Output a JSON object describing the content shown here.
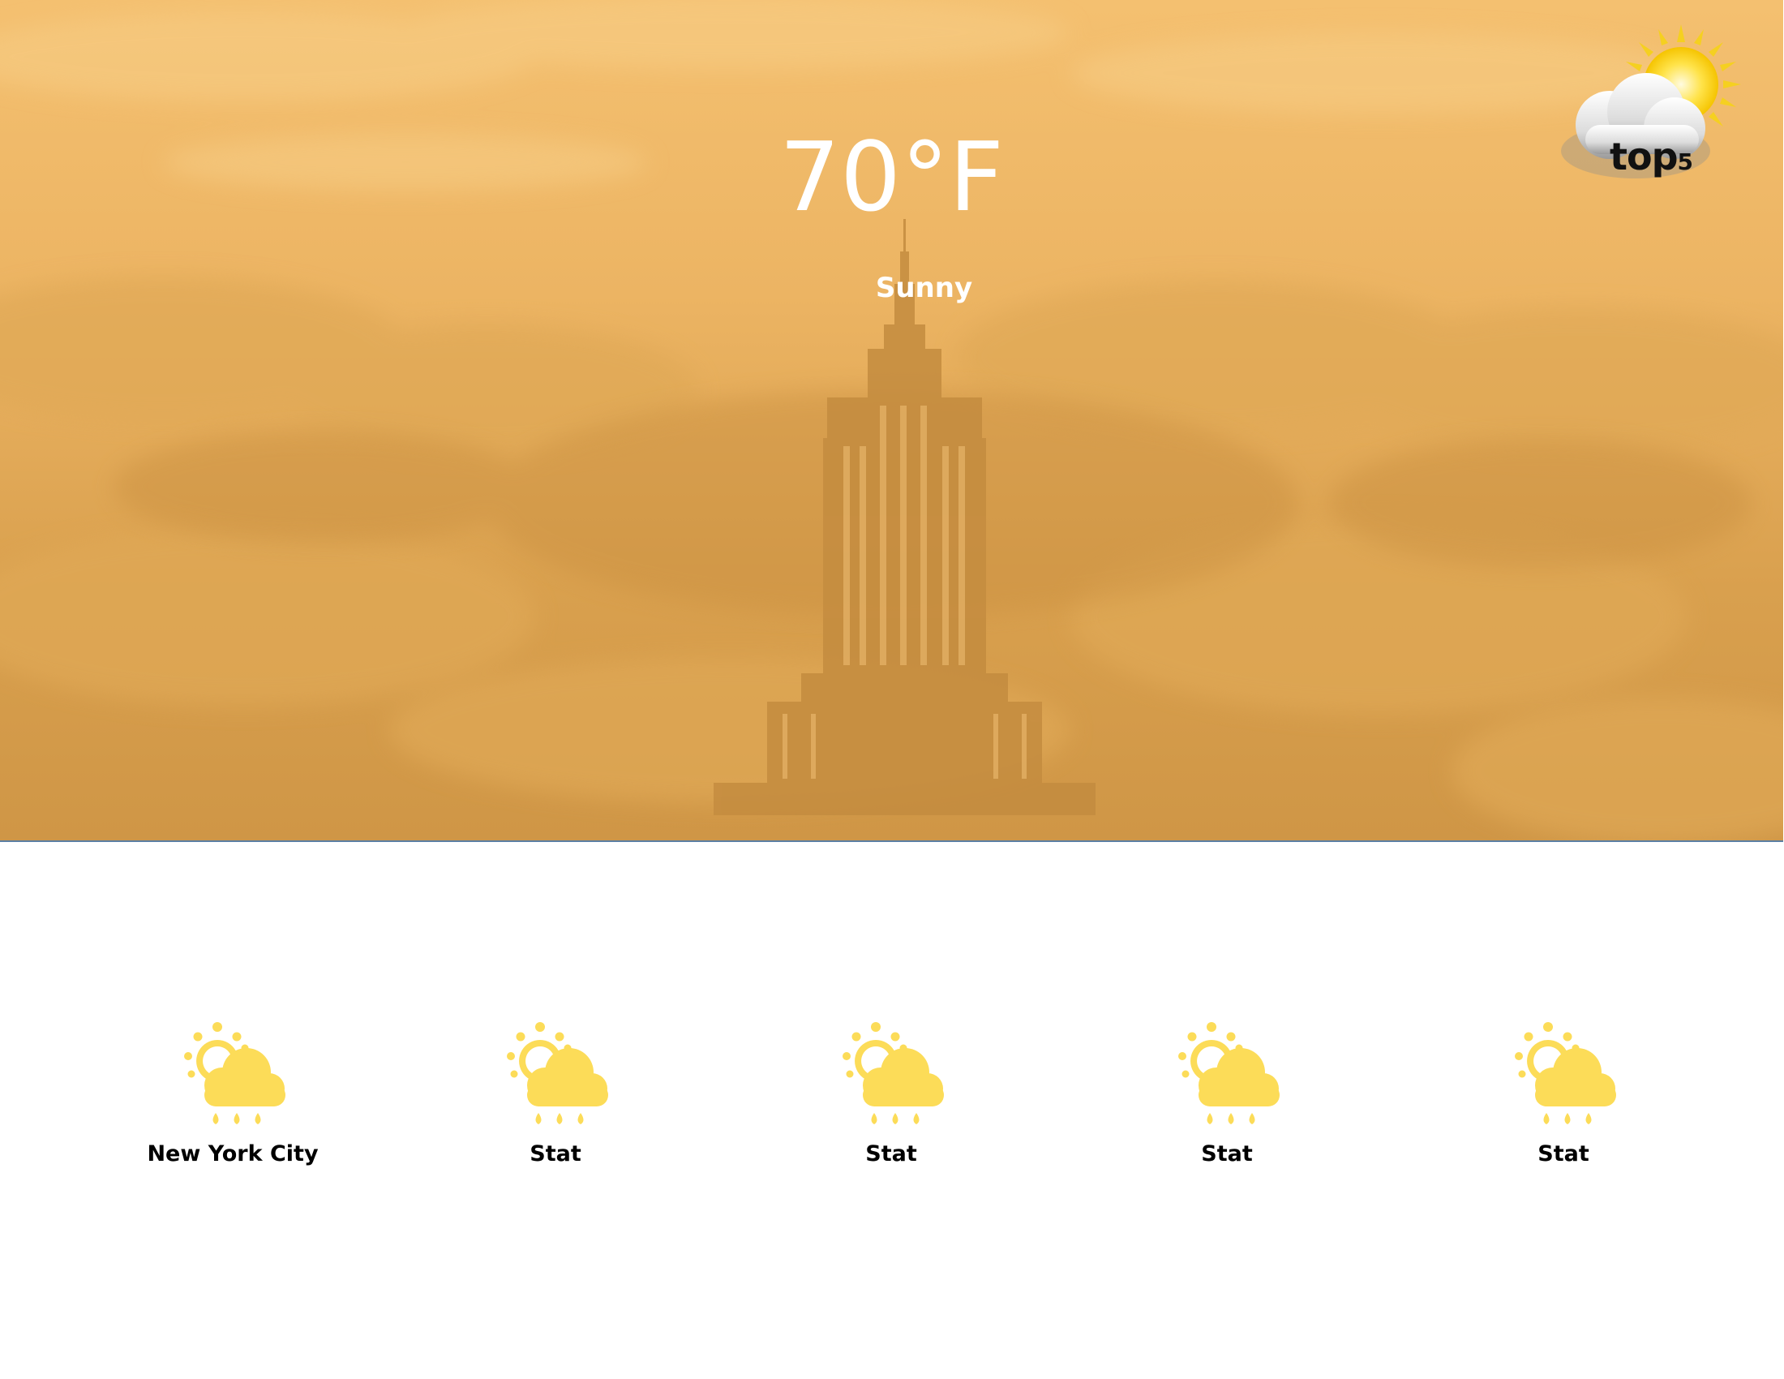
{
  "hero": {
    "temperature": "70°F",
    "condition": "Sunny",
    "background_color": "#e6ac5c"
  },
  "logo": {
    "icon": "sun-cloud-icon",
    "text_main": "top",
    "text_sub": "5"
  },
  "forecast": {
    "icon": "sun-cloud-rain-icon",
    "icon_color": "#fcdc58",
    "items": [
      {
        "label": "New York City"
      },
      {
        "label": "Stat"
      },
      {
        "label": "Stat"
      },
      {
        "label": "Stat"
      },
      {
        "label": "Stat"
      }
    ]
  }
}
